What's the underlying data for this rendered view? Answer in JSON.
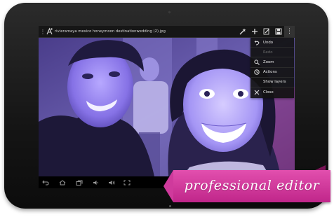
{
  "action_bar": {
    "overflow_icon": "vertical-dots-icon",
    "app_icon": "app-logo",
    "file_title": "rivieramaya mexico honeymoon destinationwedding (2).jpg",
    "buttons": [
      {
        "name": "magic-wand-button",
        "icon": "magic-wand-icon"
      },
      {
        "name": "add-button",
        "icon": "plus-icon"
      },
      {
        "name": "edit-button",
        "icon": "pencil-icon"
      },
      {
        "name": "save-button",
        "icon": "save-icon"
      },
      {
        "name": "more-options-button",
        "icon": "vertical-dots-icon"
      }
    ]
  },
  "menu": {
    "items": [
      {
        "label": "Undo",
        "icon": "undo-icon",
        "enabled": true
      },
      {
        "label": "Redo",
        "icon": "",
        "enabled": false
      },
      {
        "label": "Zoom",
        "icon": "zoom-icon",
        "enabled": true
      },
      {
        "label": "Actions",
        "icon": "history-icon",
        "enabled": true
      },
      {
        "label": "Show layers",
        "icon": "",
        "enabled": true
      },
      {
        "label": "Close",
        "icon": "close-icon",
        "enabled": true
      }
    ]
  },
  "nav_bar": {
    "icons": [
      "back-icon",
      "home-icon",
      "recent-apps-icon",
      "volume-down-icon",
      "volume-up-icon",
      "screenshot-icon"
    ]
  },
  "banner": {
    "text": "professional editor",
    "color": "#d6399f"
  },
  "colors": {
    "tablet_bezel": "#1a1a1a",
    "action_bar": "#161616",
    "photo_tint": "#7a5cff"
  }
}
